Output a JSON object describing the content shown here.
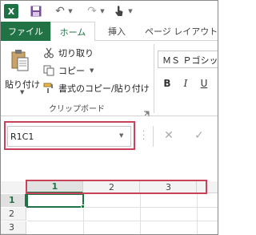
{
  "quick_access": {
    "app_icon_glyph": "X",
    "icons": [
      "excel-app-icon",
      "save-icon",
      "undo-icon",
      "redo-icon",
      "touch-mode-icon"
    ]
  },
  "tabs": [
    {
      "label": "ファイル",
      "active": false
    },
    {
      "label": "ホーム",
      "active": true
    },
    {
      "label": "挿入",
      "active": false
    },
    {
      "label": "ページ レイアウト",
      "active": false
    }
  ],
  "ribbon": {
    "clipboard": {
      "paste_label": "貼り付け",
      "cut_label": "切り取り",
      "copy_label": "コピー",
      "format_painter_label": "書式のコピー/貼り付け",
      "group_label": "クリップボード"
    },
    "font": {
      "font_name": "ＭＳ Ｐゴシック",
      "bold_label": "B",
      "italic_label": "I",
      "underline_label": "U"
    }
  },
  "formula_bar": {
    "name_box_value": "R1C1",
    "cancel_glyph": "✕",
    "enter_glyph": "✓"
  },
  "grid": {
    "column_headers": [
      "1",
      "2",
      "3"
    ],
    "row_headers": [
      "1",
      "2",
      "3"
    ],
    "active_cell": "R1C1"
  },
  "colors": {
    "accent": "#217346",
    "highlight_box": "#c8425a"
  }
}
